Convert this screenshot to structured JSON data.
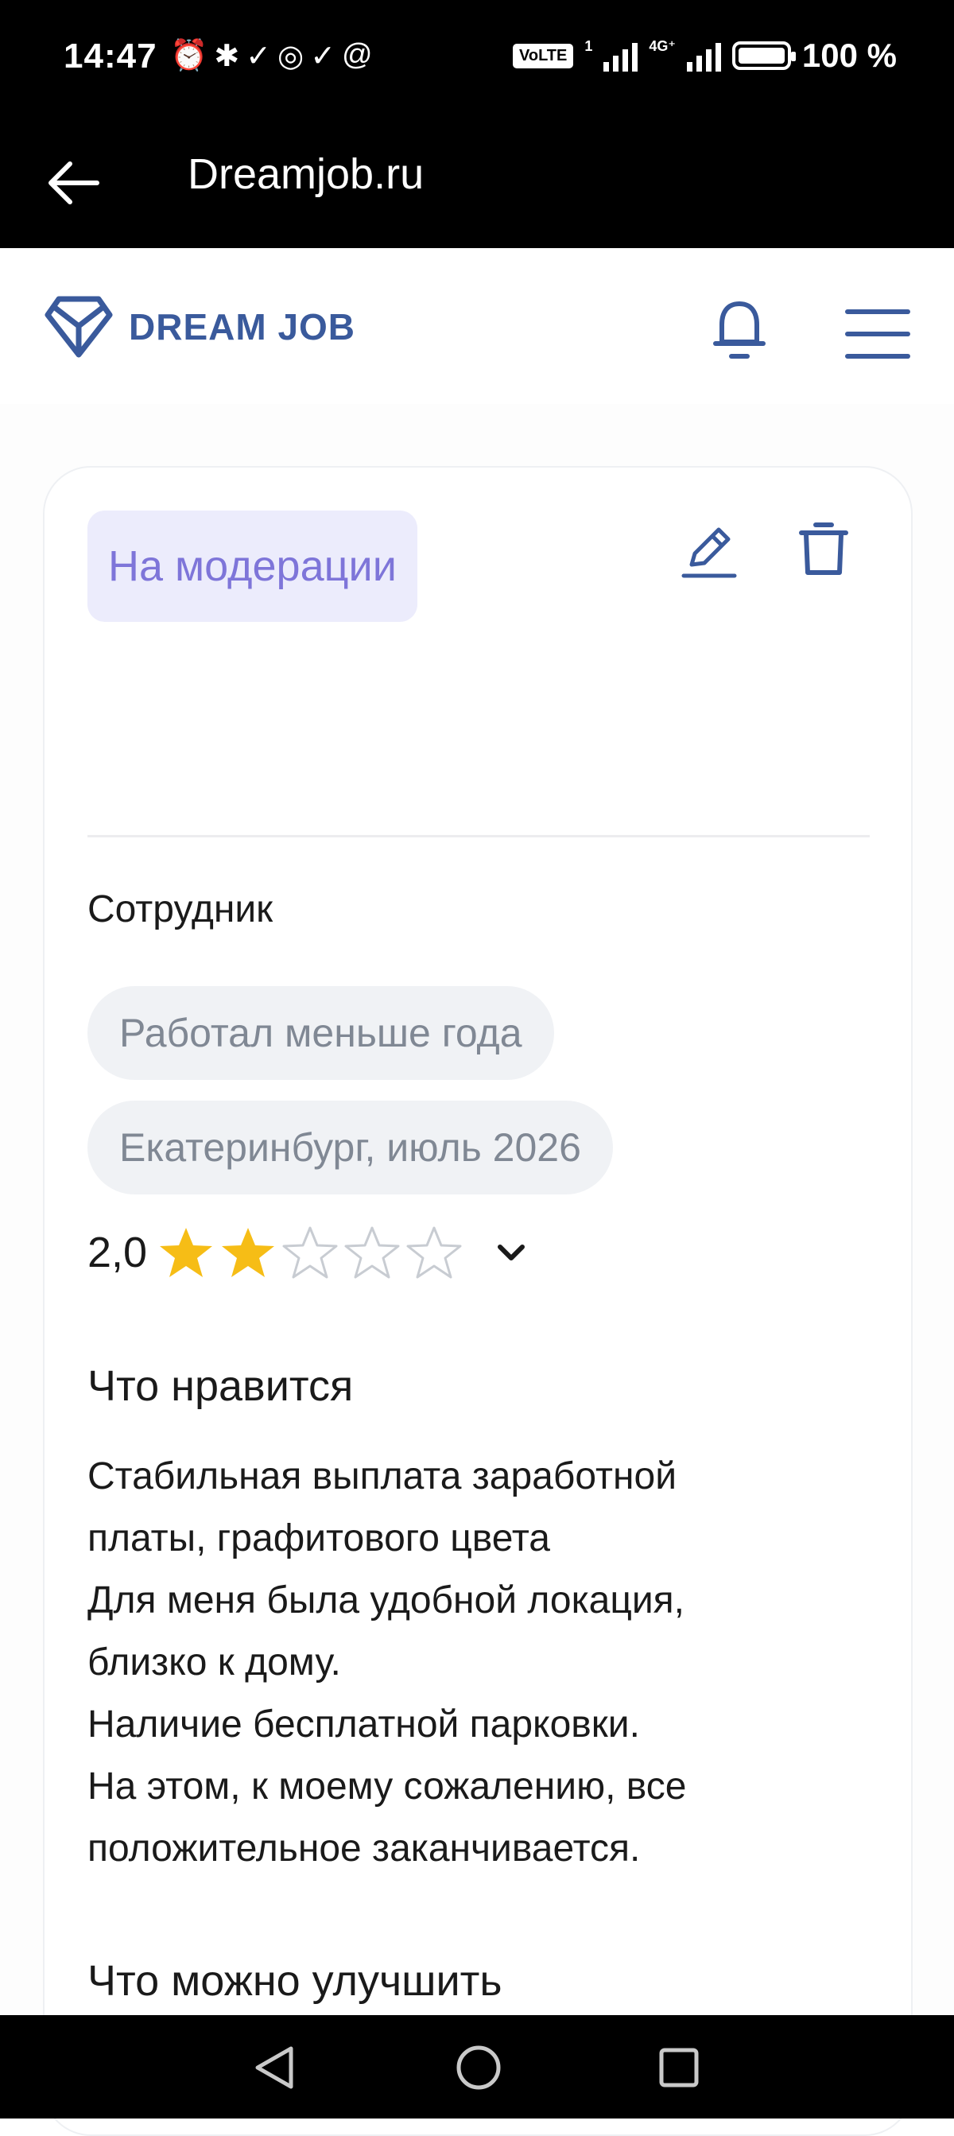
{
  "status_bar": {
    "time": "14:47",
    "network": "4G⁺",
    "volte": "VoLTE",
    "sim": "1",
    "battery": "100 %"
  },
  "app_bar": {
    "title": "Dreamjob.ru"
  },
  "header": {
    "logo_text": "DREAM JOB",
    "brand_color": "#3a5a9c"
  },
  "review": {
    "status_badge": "На модерации",
    "role": "Сотрудник",
    "tenure": "Работал меньше года",
    "location_date": "Екатеринбург, июль 2026",
    "rating_text": "2,0",
    "rating_value": 2,
    "rating_max": 5,
    "likes_title": "Что нравится",
    "likes_text": "Стабильная выплата заработной\nплаты, графитового цвета\nДля меня была удобной локация,\nблизко к дому.\nНаличие бесплатной парковки.\nНа этом, к моему сожалению, все\nположительное заканчивается.",
    "improve_title": "Что можно улучшить"
  },
  "colors": {
    "star_filled": "#f6bd16",
    "star_empty": "#c8ccd2",
    "badge_text": "#7e75d9",
    "badge_bg": "#ececfc"
  }
}
